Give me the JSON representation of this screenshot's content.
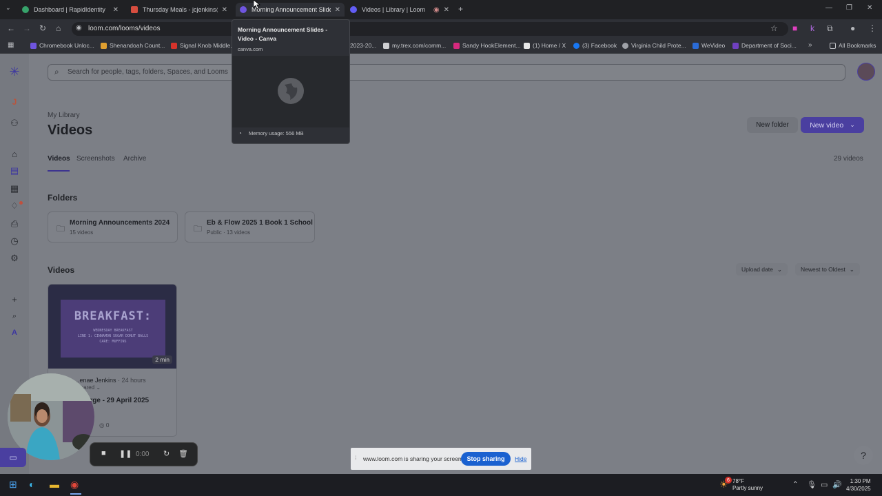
{
  "browser": {
    "tabs": [
      {
        "title": "Dashboard | RapidIdentity",
        "favicon": "#37a36b"
      },
      {
        "title": "Thursday Meals - jcjenkins@sh",
        "favicon": "#d64d3f"
      },
      {
        "title": "Morning Announcement Slide",
        "favicon": "#6f55e0"
      },
      {
        "title": "Videos | Library | Loom",
        "favicon": "#625df5"
      }
    ],
    "new_tab_icon": "plus-icon",
    "url": "loom.com/looms/videos",
    "bookmarks": [
      {
        "label": "Chromebook Unloc...",
        "color": "#6f55e0"
      },
      {
        "label": "Shenandoah Count...",
        "color": "#e0a030"
      },
      {
        "label": "Signal Knob Middle...",
        "color": "#d6332b"
      },
      {
        "label": "2023-20...",
        "color": "#7b7f86"
      },
      {
        "label": "my.trex.com/comm...",
        "color": "#cfd0d3"
      },
      {
        "label": "Sandy HookElement...",
        "color": "#d6297e"
      },
      {
        "label": "(1) Home / X",
        "color": "#e8e8e8"
      },
      {
        "label": "(3) Facebook",
        "color": "#1877f2"
      },
      {
        "label": "Virginia Child Prote...",
        "color": "#9fa2a8"
      },
      {
        "label": "WeVideo",
        "color": "#2a6bd6"
      },
      {
        "label": "Department of Soci...",
        "color": "#7040c0"
      }
    ],
    "all_bookmarks": "All Bookmarks"
  },
  "tooltip": {
    "title": "Morning Announcement Slides - Video - Canva",
    "host": "canva.com",
    "memory": "Memory usage: 556 MB"
  },
  "search": {
    "placeholder": "Search for people, tags, folders, Spaces, and Looms"
  },
  "library": {
    "breadcrumb": "My Library",
    "title": "Videos",
    "new_folder": "New folder",
    "new_video": "New video",
    "tabs": [
      "Videos",
      "Screenshots",
      "Archive"
    ],
    "count": "29 videos",
    "folders_heading": "Folders",
    "folders": [
      {
        "title": "Morning Announcements 2024",
        "sub": "15 videos"
      },
      {
        "title": "Eb & Flow 2025 1 Book 1 School",
        "sub": "Public · 13 videos"
      }
    ],
    "videos_heading": "Videos",
    "sort_field": "Upload date",
    "sort_order": "Newest to Oldest",
    "video": {
      "thumb_title": "BREAKFAST:",
      "thumb_line1": "WEDNESDAY BREAKFAST",
      "thumb_line2": "LINE 1: CINNAMON SUGAR DONUT BALLS",
      "thumb_line3": "CARE: MUFFINS",
      "duration": "2 min",
      "author": "...enae Jenkins",
      "time": "· 24 hours",
      "shared": "...hared",
      "title": "...rge - 29 April 2025",
      "views": "0"
    }
  },
  "recorder": {
    "timer": "0:00"
  },
  "sharebar": {
    "text": "www.loom.com is sharing your screen.",
    "stop": "Stop sharing",
    "hide": "Hide"
  },
  "taskbar": {
    "weather_temp": "78°F",
    "weather_desc": "Partly sunny",
    "weather_badge": "6",
    "time": "1:30 PM",
    "date": "4/30/2025"
  }
}
